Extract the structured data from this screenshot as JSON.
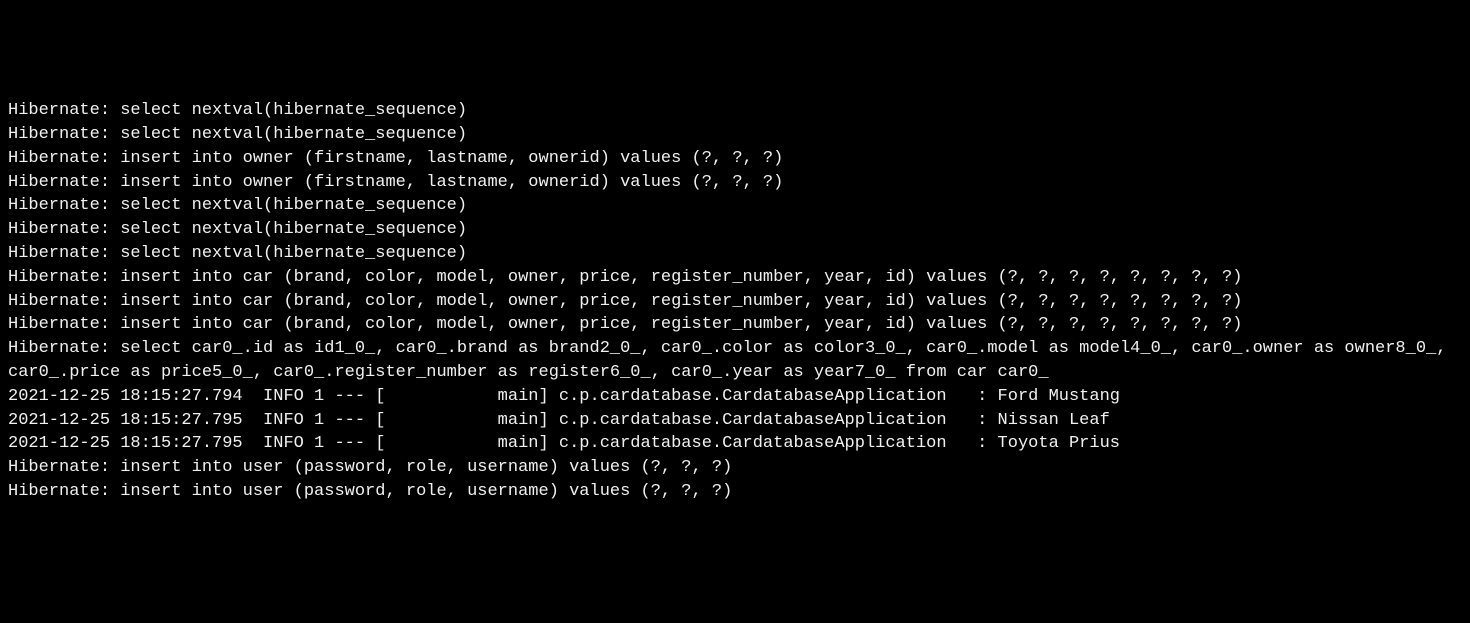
{
  "lines": [
    "Hibernate: select nextval(hibernate_sequence)",
    "Hibernate: select nextval(hibernate_sequence)",
    "Hibernate: insert into owner (firstname, lastname, ownerid) values (?, ?, ?)",
    "Hibernate: insert into owner (firstname, lastname, ownerid) values (?, ?, ?)",
    "Hibernate: select nextval(hibernate_sequence)",
    "Hibernate: select nextval(hibernate_sequence)",
    "Hibernate: select nextval(hibernate_sequence)",
    "Hibernate: insert into car (brand, color, model, owner, price, register_number, year, id) values (?, ?, ?, ?, ?, ?, ?, ?)",
    "Hibernate: insert into car (brand, color, model, owner, price, register_number, year, id) values (?, ?, ?, ?, ?, ?, ?, ?)",
    "Hibernate: insert into car (brand, color, model, owner, price, register_number, year, id) values (?, ?, ?, ?, ?, ?, ?, ?)",
    "Hibernate: select car0_.id as id1_0_, car0_.brand as brand2_0_, car0_.color as color3_0_, car0_.model as model4_0_, car0_.owner as owner8_0_, car0_.price as price5_0_, car0_.register_number as register6_0_, car0_.year as year7_0_ from car car0_",
    "2021-12-25 18:15:27.794  INFO 1 --- [           main] c.p.cardatabase.CardatabaseApplication   : Ford Mustang",
    "2021-12-25 18:15:27.795  INFO 1 --- [           main] c.p.cardatabase.CardatabaseApplication   : Nissan Leaf",
    "2021-12-25 18:15:27.795  INFO 1 --- [           main] c.p.cardatabase.CardatabaseApplication   : Toyota Prius",
    "Hibernate: insert into user (password, role, username) values (?, ?, ?)",
    "Hibernate: insert into user (password, role, username) values (?, ?, ?)"
  ]
}
